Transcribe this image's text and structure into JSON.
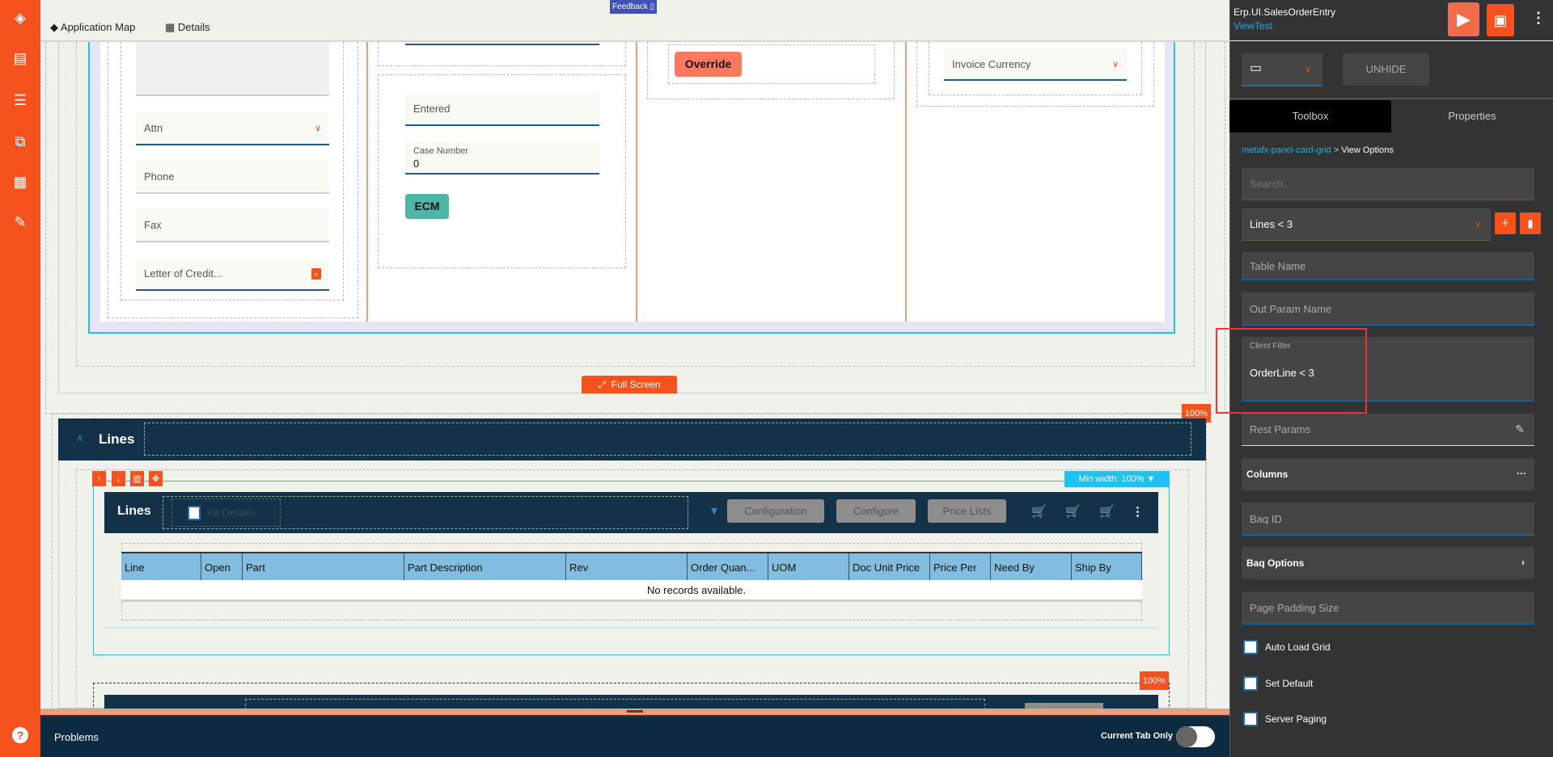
{
  "topbar": {
    "tabs": [
      {
        "label": "Application Map",
        "icon": "layers-icon"
      },
      {
        "label": "Details",
        "icon": "details-icon",
        "active": true
      }
    ],
    "feedback": "Feedback"
  },
  "form": {
    "col1": {
      "attn": "Attn",
      "phone": "Phone",
      "fax": "Fax",
      "letter_of_credit": "Letter of Credit..."
    },
    "col2": {
      "entered": "Entered",
      "case_number_label": "Case Number",
      "case_number_value": "0",
      "ecm": "ECM"
    },
    "col3": {
      "override": "Override"
    },
    "col4": {
      "invoice_currency": "Invoice Currency"
    },
    "full_screen": "Full Screen"
  },
  "lines_section": {
    "title": "Lines",
    "badge": "100%",
    "min_width": "Min width: 100%",
    "grid": {
      "title": "Lines",
      "kit_details": "Kit Details",
      "buttons": [
        "Configuration",
        "Configure",
        "Price Lists"
      ],
      "columns": [
        "Line",
        "Open",
        "Part",
        "Part Description",
        "Rev",
        "Order Quan...",
        "UOM",
        "Doc Unit Price",
        "Price Per",
        "Need By",
        "Ship By"
      ],
      "empty": "No records available."
    }
  },
  "second_badge": "100%",
  "problems": {
    "title": "Problems",
    "current_tab_only": "Current Tab Only"
  },
  "right_panel": {
    "app_name": "Erp.UI.SalesOrderEntry",
    "view_name": "ViewTest",
    "unhide": "UNHIDE",
    "tabs": [
      "Toolbox",
      "Properties"
    ],
    "breadcrumb": {
      "parent": "metafx-panel-card-grid",
      "separator": ">",
      "current": "View Options"
    },
    "search_placeholder": "Search..",
    "view_select": "Lines < 3",
    "fields": {
      "table_name": "Table Name",
      "out_param_name": "Out Param Name",
      "client_filter_label": "Client Filter",
      "client_filter_value": "OrderLine < 3",
      "rest_params": "Rest Params",
      "columns": "Columns",
      "baq_id": "Baq ID",
      "baq_options": "Baq Options",
      "page_padding_size": "Page Padding Size"
    },
    "checkboxes": [
      {
        "label": "Auto Load Grid",
        "checked": false
      },
      {
        "label": "Set Default",
        "checked": false
      },
      {
        "label": "Server Paging",
        "checked": false
      }
    ]
  },
  "colors": {
    "accent": "#f5521d",
    "navy": "#133247",
    "highlight": "#e53935",
    "header_blue": "#82bde0"
  }
}
